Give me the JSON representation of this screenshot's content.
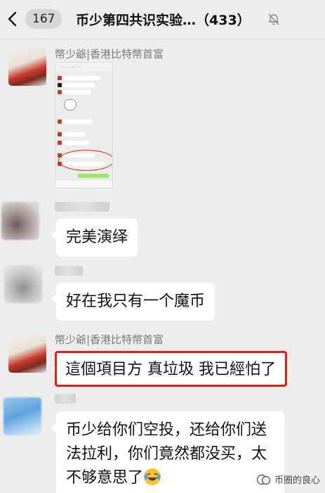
{
  "header": {
    "unread_count": "167",
    "title": "币少第四共识实验…（433）"
  },
  "messages": [
    {
      "sender": "幣少爺|香港比特幣首富",
      "type": "image"
    },
    {
      "sender": "",
      "type": "text",
      "text": "完美演绎"
    },
    {
      "sender": "",
      "type": "text",
      "text": "好在我只有一个魔币"
    },
    {
      "sender": "幣少爺|香港比特幣首富",
      "type": "text",
      "text": "這個項目方 真垃圾 我已經怕了",
      "highlighted": true
    },
    {
      "sender": "",
      "type": "text",
      "lines": [
        "币少给你们空投，还给你们送",
        "法拉利，你们竟然都没买，太",
        "不够意思了"
      ]
    }
  ],
  "watermark": {
    "text": "币圈的良心"
  },
  "colors": {
    "background": "#ededed",
    "bubble": "#ffffff",
    "highlight": "#e0211b"
  }
}
